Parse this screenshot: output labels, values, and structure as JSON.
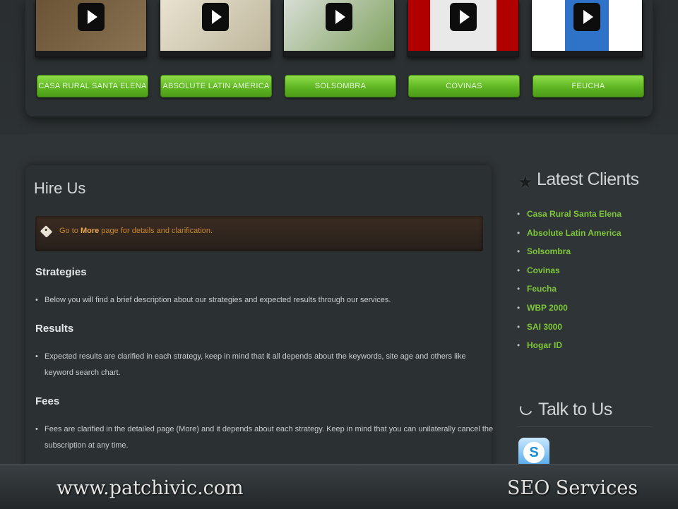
{
  "portfolio": {
    "items": [
      {
        "label": "CASA RURAL SANTA ELENA",
        "colors": [
          "#6b5437",
          "#8a7352"
        ]
      },
      {
        "label": "ABSOLUTE LATIN AMERICA",
        "colors": [
          "#e8e2d0",
          "#bdb59a"
        ]
      },
      {
        "label": "SOLSOMBRA",
        "colors": [
          "#d8ddd6",
          "#7ca05a"
        ]
      },
      {
        "label": "COVINAS",
        "colors": [
          "#b00000",
          "#e9e9e9"
        ]
      },
      {
        "label": "FEUCHA",
        "colors": [
          "#ffffff",
          "#2f73c8"
        ]
      }
    ]
  },
  "hire": {
    "title": "Hire Us",
    "notice_prefix": "Go to ",
    "notice_link": "More",
    "notice_suffix": " page for details and clarification."
  },
  "sections": [
    {
      "heading": "Strategies",
      "text": "Below you will find a brief description about our strategies and expected results through our services."
    },
    {
      "heading": "Results",
      "text": "Expected results are clarified in each strategy, keep in mind that it all depends about the keywords, site age and others like keyword search chart."
    },
    {
      "heading": "Fees",
      "text": "Fees are clarified in the detailed page (More) and it depends about each strategy. Keep in mind that you can unilaterally cancel the subscription at any time."
    }
  ],
  "sidebar": {
    "latest_title": "Latest Clients",
    "clients": [
      "Casa Rural Santa Elena",
      "Absolute Latin America",
      "Solsombra",
      "Covinas",
      "Feucha",
      "WBP 2000",
      "SAI 3000",
      "Hogar ID"
    ],
    "talk_title": "Talk to Us"
  },
  "footer": {
    "site": "www.patchivic.com",
    "service": "SEO Services"
  },
  "colors": {
    "accent_green": "#7ec63b",
    "notice_text": "#c7862f"
  }
}
